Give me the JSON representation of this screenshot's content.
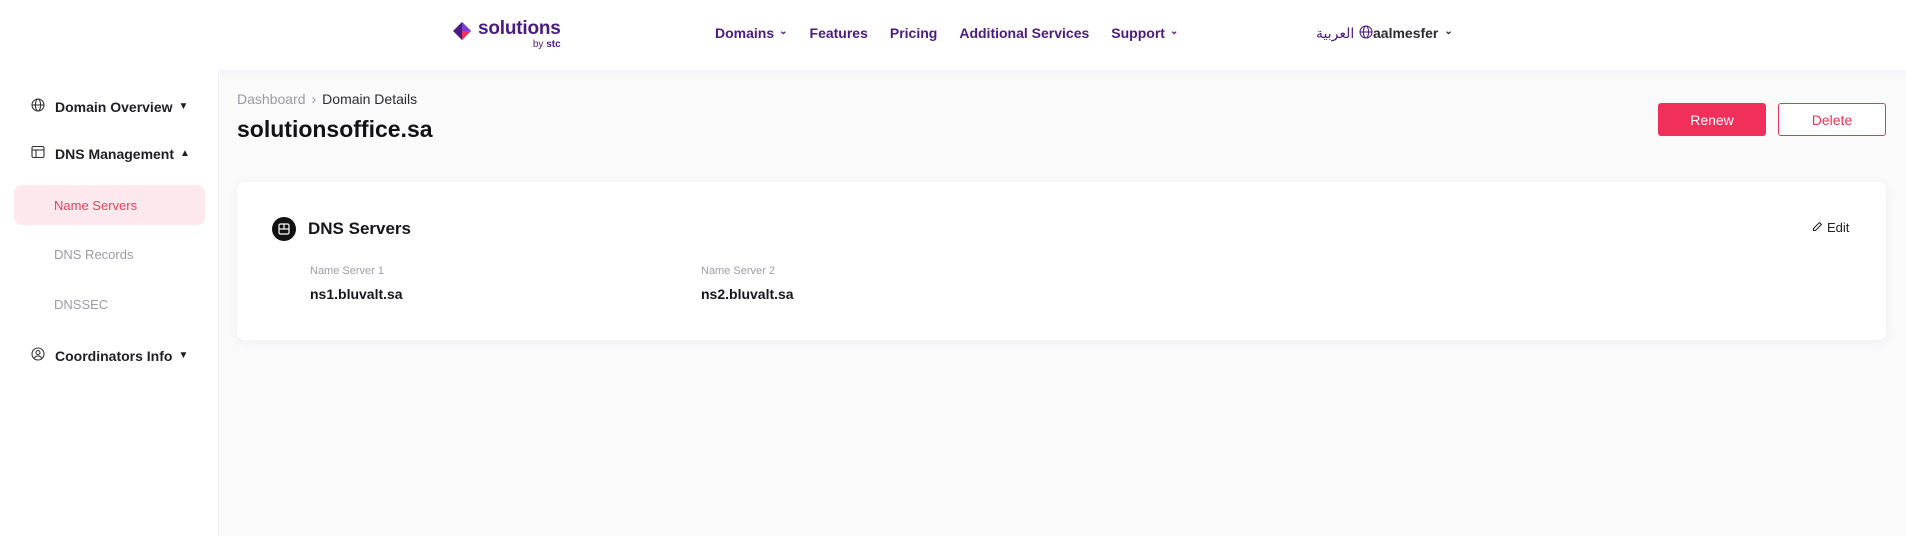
{
  "brand": {
    "name": "solutions",
    "sub_prefix": "by",
    "sub_brand": "stc"
  },
  "nav": [
    {
      "label": "Domains",
      "dropdown": true
    },
    {
      "label": "Features",
      "dropdown": false
    },
    {
      "label": "Pricing",
      "dropdown": false
    },
    {
      "label": "Additional Services",
      "dropdown": false
    },
    {
      "label": "Support",
      "dropdown": true
    }
  ],
  "language": {
    "label": "العربية"
  },
  "user": {
    "name": "aalmesfer"
  },
  "sidebar": {
    "domain_overview": "Domain Overview",
    "dns_management": "DNS Management",
    "sub_items": [
      "Name Servers",
      "DNS Records",
      "DNSSEC"
    ],
    "coordinators_info": "Coordinators Info"
  },
  "breadcrumb": {
    "root": "Dashboard",
    "current": "Domain Details"
  },
  "page": {
    "title": "solutionsoffice.sa"
  },
  "actions": {
    "renew": "Renew",
    "delete": "Delete"
  },
  "dns_card": {
    "title": "DNS Servers",
    "edit_label": "Edit",
    "servers": [
      {
        "label": "Name Server 1",
        "value": "ns1.bluvalt.sa"
      },
      {
        "label": "Name Server 2",
        "value": "ns2.bluvalt.sa"
      }
    ]
  },
  "colors": {
    "brand_purple": "#4b1a82",
    "accent_pink": "#f0305a",
    "active_bg": "#fde8ee"
  }
}
